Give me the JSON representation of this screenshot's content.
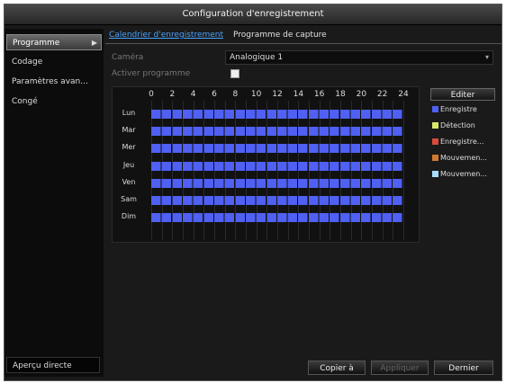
{
  "window": {
    "title": "Configuration d'enregistrement"
  },
  "sidebar": {
    "items": [
      {
        "label": "Programme",
        "active": true
      },
      {
        "label": "Codage"
      },
      {
        "label": "Paramètres avan..."
      },
      {
        "label": "Congé"
      }
    ],
    "live_view": "Aperçu directe"
  },
  "tabs": [
    {
      "label": "Calendrier d'enregistrement",
      "active": true
    },
    {
      "label": "Programme de capture"
    }
  ],
  "form": {
    "camera_label": "Caméra",
    "camera_value": "Analogique 1",
    "activate_label": "Activer programme",
    "activate_checked": true
  },
  "schedule": {
    "hours": [
      "0",
      "2",
      "4",
      "6",
      "8",
      "10",
      "12",
      "14",
      "16",
      "18",
      "20",
      "22",
      "24"
    ],
    "days": [
      "Lun",
      "Mar",
      "Mer",
      "Jeu",
      "Ven",
      "Sam",
      "Dim"
    ],
    "fill_color": "#4f60f2",
    "coverage": "0-24"
  },
  "edit_button": "Editer",
  "legend": [
    {
      "label": "Enregistre",
      "color": "#4f60f2"
    },
    {
      "label": "Détection",
      "color": "#d8e86a"
    },
    {
      "label": "Enregistre...",
      "color": "#d84a3a"
    },
    {
      "label": "Mouvemen...",
      "color": "#d07a30"
    },
    {
      "label": "Mouvemen...",
      "color": "#a8dcff"
    }
  ],
  "buttons": {
    "copy": "Copier à",
    "apply": "Appliquer",
    "back": "Dernier"
  }
}
